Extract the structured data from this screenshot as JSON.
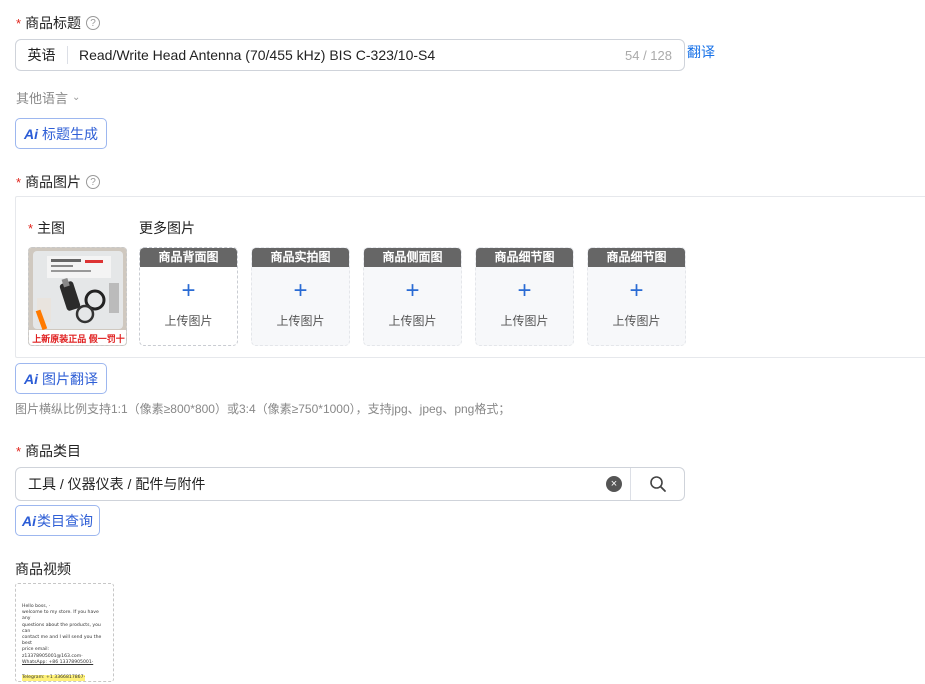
{
  "title_section": {
    "label": "商品标题",
    "help": "?",
    "language": "英语",
    "value": "Read/Write Head Antenna (70/455 kHz) BIS C-323/10-S4",
    "counter": "54 / 128",
    "translate": "翻译"
  },
  "other_language": {
    "label": "其他语言",
    "chevron": "⌄"
  },
  "ai_title_button": {
    "ai": "Ai",
    "label": "标题生成"
  },
  "image_section": {
    "label": "商品图片",
    "help": "?",
    "main_label": "主图",
    "more_label": "更多图片",
    "main_banner": "上新原装正品 假一罚十",
    "slots": [
      {
        "title": "商品背面图",
        "plus": "+",
        "text": "上传图片"
      },
      {
        "title": "商品实拍图",
        "plus": "+",
        "text": "上传图片"
      },
      {
        "title": "商品侧面图",
        "plus": "+",
        "text": "上传图片"
      },
      {
        "title": "商品细节图",
        "plus": "+",
        "text": "上传图片"
      },
      {
        "title": "商品细节图",
        "plus": "+",
        "text": "上传图片"
      }
    ]
  },
  "ai_image_button": {
    "ai": "Ai",
    "label": "图片翻译"
  },
  "image_hint": "图片横纵比例支持1:1（像素≥800*800）或3:4（像素≥750*1000），支持jpg、jpeg、png格式；",
  "category_section": {
    "label": "商品类目",
    "value": "工具 / 仪器仪表 / 配件与附件",
    "clear": "×"
  },
  "ai_category_button": {
    "ai": "Ai",
    "label": "类目查询"
  },
  "video_section": {
    "label": "商品视频",
    "lines": [
      "Hello boss, ·",
      "welcome to my store. If you have any",
      "questions about the products, you can",
      "contact me and I will send you the best",
      "price email: z13378905001@163.com·",
      "WhatsApp: +86 13378905001·",
      "Telegram: +1 3366817867·"
    ]
  },
  "colors": {
    "accent": "#1a73e8",
    "required": "#e0241b",
    "slot_header": "#666666"
  }
}
